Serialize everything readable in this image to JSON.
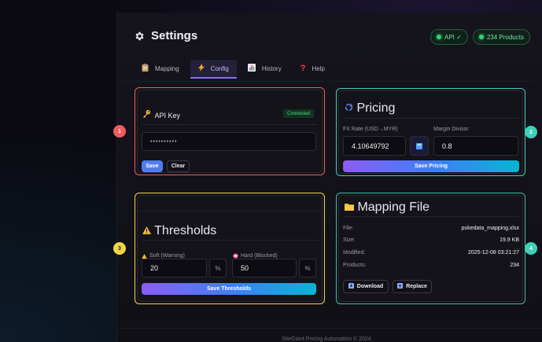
{
  "header": {
    "title": "Settings"
  },
  "status": {
    "api": "API ✓",
    "products": "234 Products"
  },
  "tabs": [
    {
      "label": "Mapping",
      "icon": "clipboard-icon"
    },
    {
      "label": "Config",
      "icon": "lightning-icon"
    },
    {
      "label": "History",
      "icon": "bar-chart-icon"
    },
    {
      "label": "Help",
      "icon": "question-icon"
    }
  ],
  "api_card": {
    "title": "API Key",
    "status": "Connected",
    "value": "••••••••••",
    "save": "Save",
    "clear": "Clear"
  },
  "pricing": {
    "title": "Pricing",
    "fx_label": "FX Rate (USD→MYR)",
    "fx_value": "4.10649792",
    "margin_label": "Margin Divisor",
    "margin_value": "0.8",
    "save": "Save Pricing"
  },
  "thresholds": {
    "title": "Thresholds",
    "soft_label": "Soft (Warning)",
    "soft_value": "20",
    "hard_label": "Hard (Blocked)",
    "hard_value": "50",
    "unit": "%",
    "save": "Save Thresholds"
  },
  "mapping": {
    "title": "Mapping File",
    "rows": [
      {
        "k": "File:",
        "v": "pokedata_mapping.xlsx"
      },
      {
        "k": "Size:",
        "v": "19.9 KB"
      },
      {
        "k": "Modified:",
        "v": "2025-12-08 03:21:27"
      },
      {
        "k": "Products:",
        "v": "234"
      }
    ],
    "download": "Download",
    "replace": "Replace"
  },
  "markers": [
    "1",
    "2",
    "3",
    "4"
  ],
  "colors": {
    "red": "#ef5b61",
    "teal": "#3fd0b8",
    "yellow": "#f2d548"
  },
  "footer": "SiteGiant Pricing Automation © 2024"
}
